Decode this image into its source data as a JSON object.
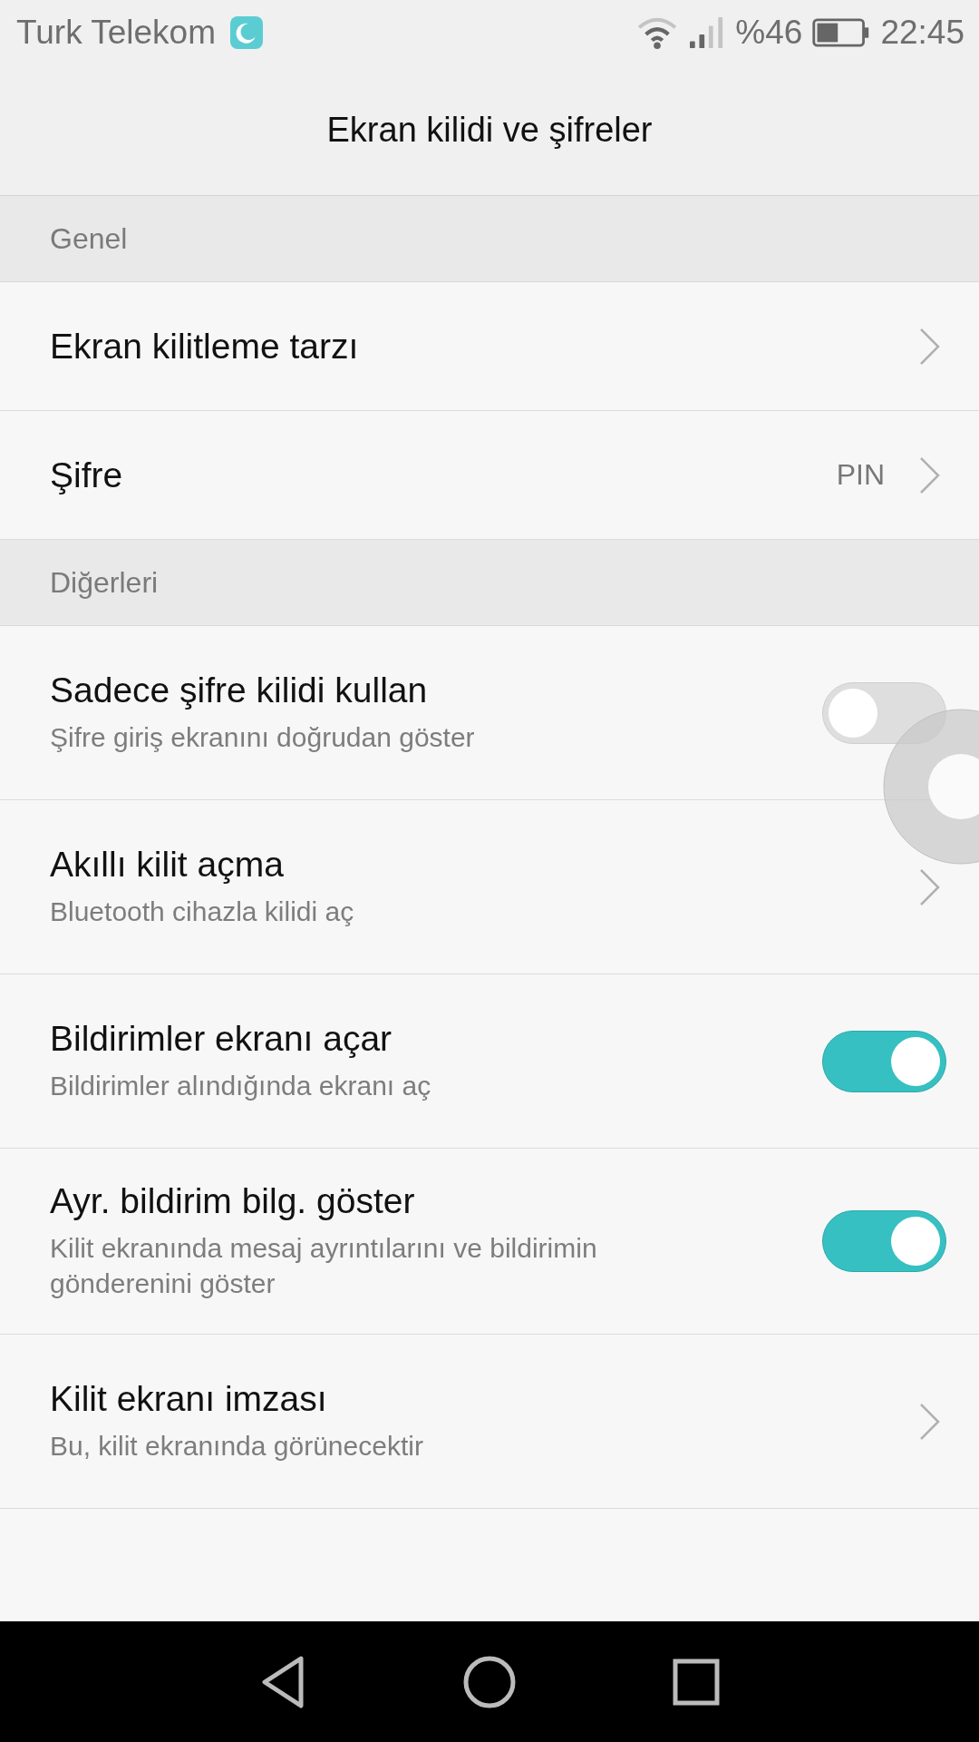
{
  "status_bar": {
    "carrier": "Turk Telekom",
    "battery_percent": "%46",
    "time": "22:45"
  },
  "title": "Ekran kilidi ve şifreler",
  "sections": [
    {
      "header": "Genel",
      "rows": [
        {
          "kind": "link",
          "title": "Ekran kilitleme tarzı"
        },
        {
          "kind": "link",
          "title": "Şifre",
          "value": "PIN"
        }
      ]
    },
    {
      "header": "Diğerleri",
      "rows": [
        {
          "kind": "toggle",
          "title": "Sadece şifre kilidi kullan",
          "subtitle": "Şifre giriş ekranını doğrudan göster",
          "on": false
        },
        {
          "kind": "link",
          "title": "Akıllı kilit açma",
          "subtitle": "Bluetooth cihazla kilidi aç"
        },
        {
          "kind": "toggle",
          "title": "Bildirimler ekranı açar",
          "subtitle": "Bildirimler alındığında ekranı aç",
          "on": true
        },
        {
          "kind": "toggle",
          "title": "Ayr. bildirim bilg. göster",
          "subtitle": "Kilit ekranında mesaj ayrıntılarını ve bildirimin gönderenini göster",
          "on": true
        },
        {
          "kind": "link",
          "title": "Kilit ekranı imzası",
          "subtitle": "Bu, kilit ekranında görünecektir"
        }
      ]
    }
  ]
}
